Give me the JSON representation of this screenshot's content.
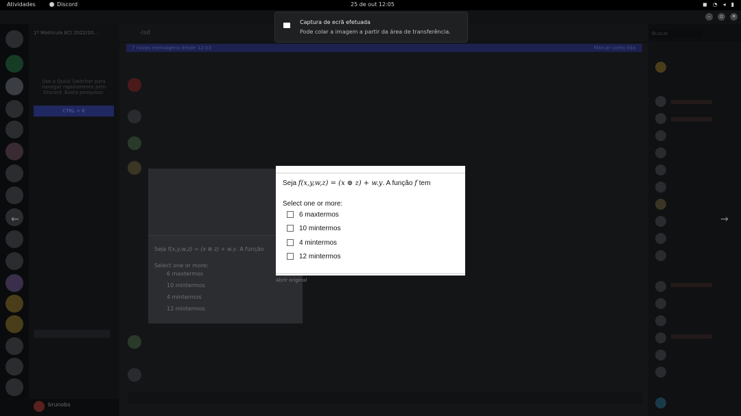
{
  "topbar": {
    "activities": "Atividades",
    "app_name": "Discord",
    "clock": "25 de out  12:05"
  },
  "toast": {
    "title": "Captura de ecrã efetuada",
    "body": "Pode colar a imagem a partir da área de transferência."
  },
  "discord": {
    "guild_name": "1º Matricula ECI 2022/20...",
    "quick_switcher_hint": "Use o Quick Switcher para navegar rapidamente pelo Discord. Basta pesquisar.",
    "quick_switcher_key": "CTRL + K",
    "channel_title": "-isd",
    "banner_left": "7 novas mensagens desde 12:03",
    "banner_right": "Marcar como lida",
    "search_placeholder": "Buscar",
    "current_user": "brunobs"
  },
  "image_viewer": {
    "question_prefix": "Seja ",
    "question_formula": "f(x,y,w,z) = (x ⊕ z) + w.y",
    "question_suffix": ". A função ",
    "question_func": "f",
    "question_end": " tem",
    "select_label": "Select one or more:",
    "options": [
      "6 maxtermos",
      "10 mintermos",
      "4 mintermos",
      "12 mintermos"
    ],
    "open_original": "Abrir original"
  }
}
